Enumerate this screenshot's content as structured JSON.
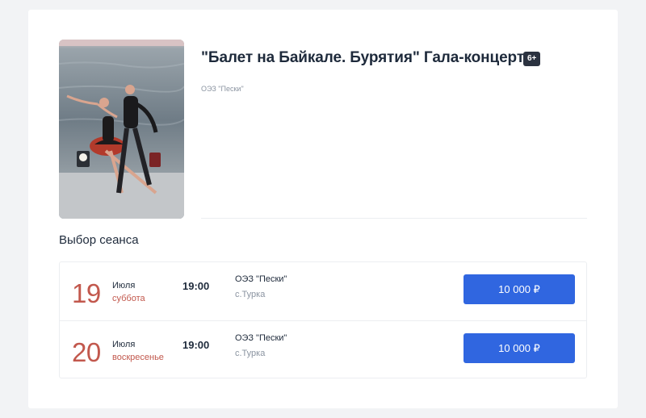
{
  "event": {
    "title": "\"Балет на Байкале. Бурятия\" Гала-концерт",
    "age_rating": "6+",
    "venue": "ОЭЗ \"Пески\""
  },
  "schedule": {
    "heading": "Выбор сеанса",
    "sessions": [
      {
        "day": "19",
        "month": "Июля",
        "weekday": "суббота",
        "time": "19:00",
        "place": "ОЭЗ \"Пески\"",
        "city": "с.Турка",
        "price": "10 000 ₽"
      },
      {
        "day": "20",
        "month": "Июля",
        "weekday": "воскресенье",
        "time": "19:00",
        "place": "ОЭЗ \"Пески\"",
        "city": "с.Турка",
        "price": "10 000 ₽"
      }
    ]
  },
  "colors": {
    "accent_button": "#3066e0",
    "date_red": "#c2584d",
    "text_dark": "#1e2a3b",
    "text_muted": "#8b94a1",
    "page_bg": "#f2f3f5"
  }
}
